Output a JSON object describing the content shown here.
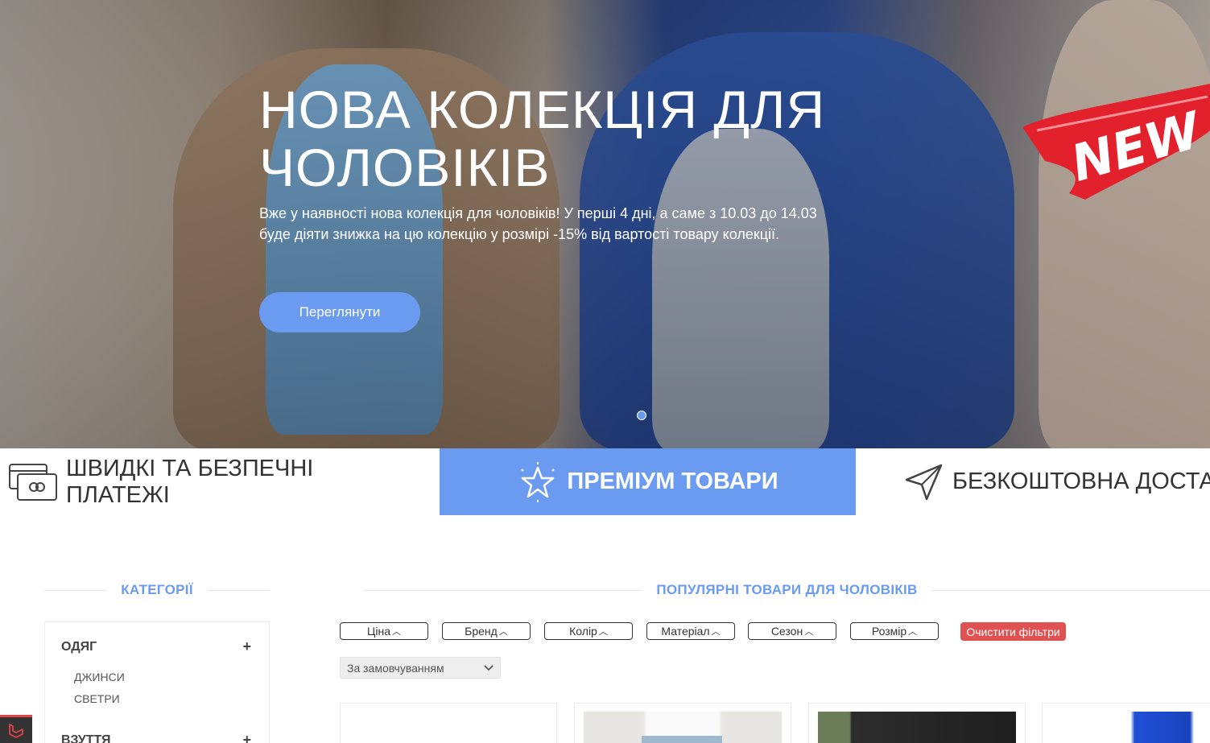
{
  "hero": {
    "title": "НОВА КОЛЕКЦІЯ ДЛЯ ЧОЛОВІКІВ",
    "text": "Вже у наявності нова колекція для чоловіків! У перші 4 дні, а саме з 10.03 до 14.03 буде діяти знижка на цю колекцію у розмірі -15% від вартості товару колекції.",
    "button_label": "Переглянути",
    "badge_label": "NEW"
  },
  "features": {
    "payments": "ШВИДКІ ТА БЕЗПЕЧНІ ПЛАТЕЖІ",
    "premium": "ПРЕМІУМ ТОВАРИ",
    "shipping": "БЕЗКОШТОВНА ДОСТАВКА"
  },
  "categories": {
    "title": "КАТЕГОРІЇ",
    "groups": [
      {
        "name": "ОДЯГ",
        "items": [
          "ДЖИНСИ",
          "СВЕТРИ"
        ]
      },
      {
        "name": "ВЗУТТЯ",
        "items": []
      }
    ]
  },
  "popular": {
    "title": "ПОПУЛЯРНІ ТОВАРИ ДЛЯ ЧОЛОВІКІВ"
  },
  "filters": [
    "Ціна",
    "Бренд",
    "Колір",
    "Матеріал",
    "Сезон",
    "Розмір"
  ],
  "clear_filters_label": "Очистити фільтри",
  "sort": {
    "selected": "За замовчуванням"
  },
  "colors": {
    "accent": "#6a9bf0",
    "danger": "#e05252",
    "badge_red": "#e3212c"
  }
}
